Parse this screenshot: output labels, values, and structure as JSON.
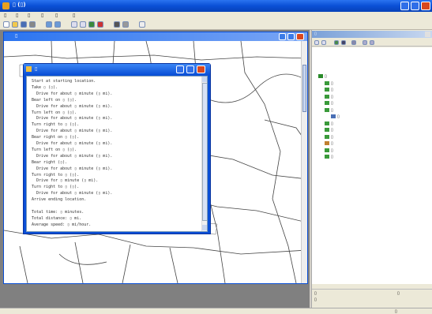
{
  "app": {
    "title": "▯ (▯)",
    "colors": {
      "titlebar": "#0a4fd6",
      "titlebar_end": "#1a6cf0",
      "map_bg": "#ffffff",
      "panel_bg": "#d4d0c8",
      "dark_bg": "#808080"
    }
  },
  "menubar": [
    "▯",
    "▯",
    "▯",
    "▯",
    "▯",
    "▯"
  ],
  "toolbar": {
    "icons": [
      "new-icon",
      "open-icon",
      "save-icon",
      "print-icon",
      "undo-icon",
      "redo-icon",
      "zoom-icon",
      "pan-icon",
      "identify-icon",
      "select-icon",
      "find-icon",
      "measure-icon",
      "help-icon"
    ]
  },
  "map_window": {
    "title": "▯"
  },
  "directions": {
    "title": "▯",
    "lines": [
      "Start at starting location.",
      "Take ▯ (▯).",
      "  Drive for about ▯ minute (▯ mi).",
      "Bear left on ▯ (▯).",
      "  Drive for about ▯ minute (▯ mi).",
      "Turn left on ▯ (▯).",
      "  Drive for about ▯ minute (▯ mi).",
      "Turn right to ▯ (▯).",
      "  Drive for about ▯ minute (▯ mi).",
      "Bear right on ▯ (▯).",
      "  Drive for about ▯ minute (▯ mi).",
      "Turn left on ▯ (▯).",
      "  Drive for about ▯ minute (▯ mi).",
      "Bear right (▯).",
      "  Drive for about ▯ minute (▯ mi).",
      "Turn right to ▯ (▯).",
      "  Drive for ▯ minute (▯ mi).",
      "Turn right to ▯ (▯).",
      "  Drive for about ▯ minute (▯ mi).",
      "Arrive ending location.",
      "",
      "Total time: ▯ minutes.",
      "Total distance: ▯ mi.",
      "Average speed: ▯ mi/hour."
    ]
  },
  "catalog": {
    "title": "▯",
    "items": [
      {
        "label": "▯",
        "icon": "layer-group-icon",
        "depth": 0
      },
      {
        "label": "▯",
        "icon": "layer-icon",
        "depth": 1
      },
      {
        "label": "▯",
        "icon": "layer-icon",
        "depth": 1
      },
      {
        "label": "▯",
        "icon": "layer-icon",
        "depth": 1
      },
      {
        "label": "▯",
        "icon": "layer-icon",
        "depth": 1
      },
      {
        "label": "▯",
        "icon": "layer-icon",
        "depth": 1
      },
      {
        "label": "▯",
        "icon": "table-icon",
        "depth": 2
      },
      {
        "label": "▯",
        "icon": "layer-icon",
        "depth": 1
      },
      {
        "label": "▯",
        "icon": "layer-icon",
        "depth": 1
      },
      {
        "label": "▯",
        "icon": "layer-icon",
        "depth": 1
      },
      {
        "label": "▯",
        "icon": "image-icon",
        "depth": 1
      },
      {
        "label": "▯",
        "icon": "map-icon",
        "depth": 1
      },
      {
        "label": "▯",
        "icon": "layer-icon",
        "depth": 1
      }
    ],
    "footer_left": "▯",
    "footer_right": "▯",
    "footer_sub": "▯"
  },
  "statusbar": {
    "coords": "▯"
  }
}
